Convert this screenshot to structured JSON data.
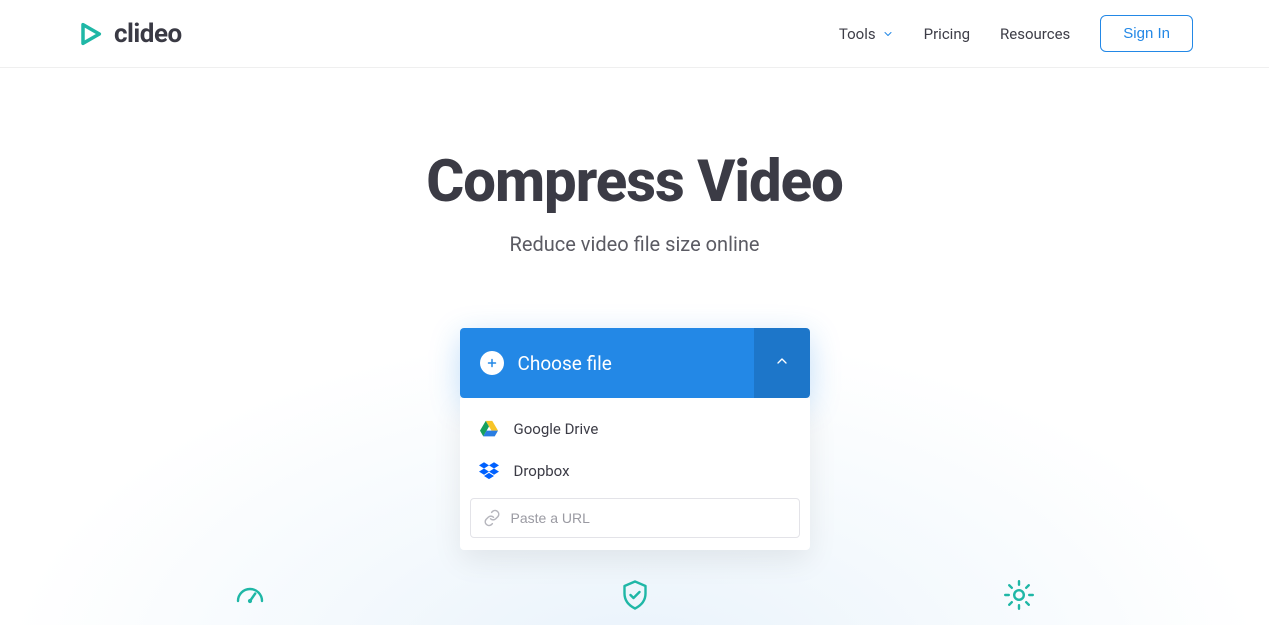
{
  "brand": {
    "name": "clideo"
  },
  "nav": {
    "tools": "Tools",
    "pricing": "Pricing",
    "resources": "Resources",
    "signin": "Sign In"
  },
  "hero": {
    "title": "Compress Video",
    "subtitle": "Reduce video file size online"
  },
  "upload": {
    "choose_label": "Choose file",
    "options": {
      "gdrive": "Google Drive",
      "dropbox": "Dropbox"
    },
    "url_placeholder": "Paste a URL"
  }
}
